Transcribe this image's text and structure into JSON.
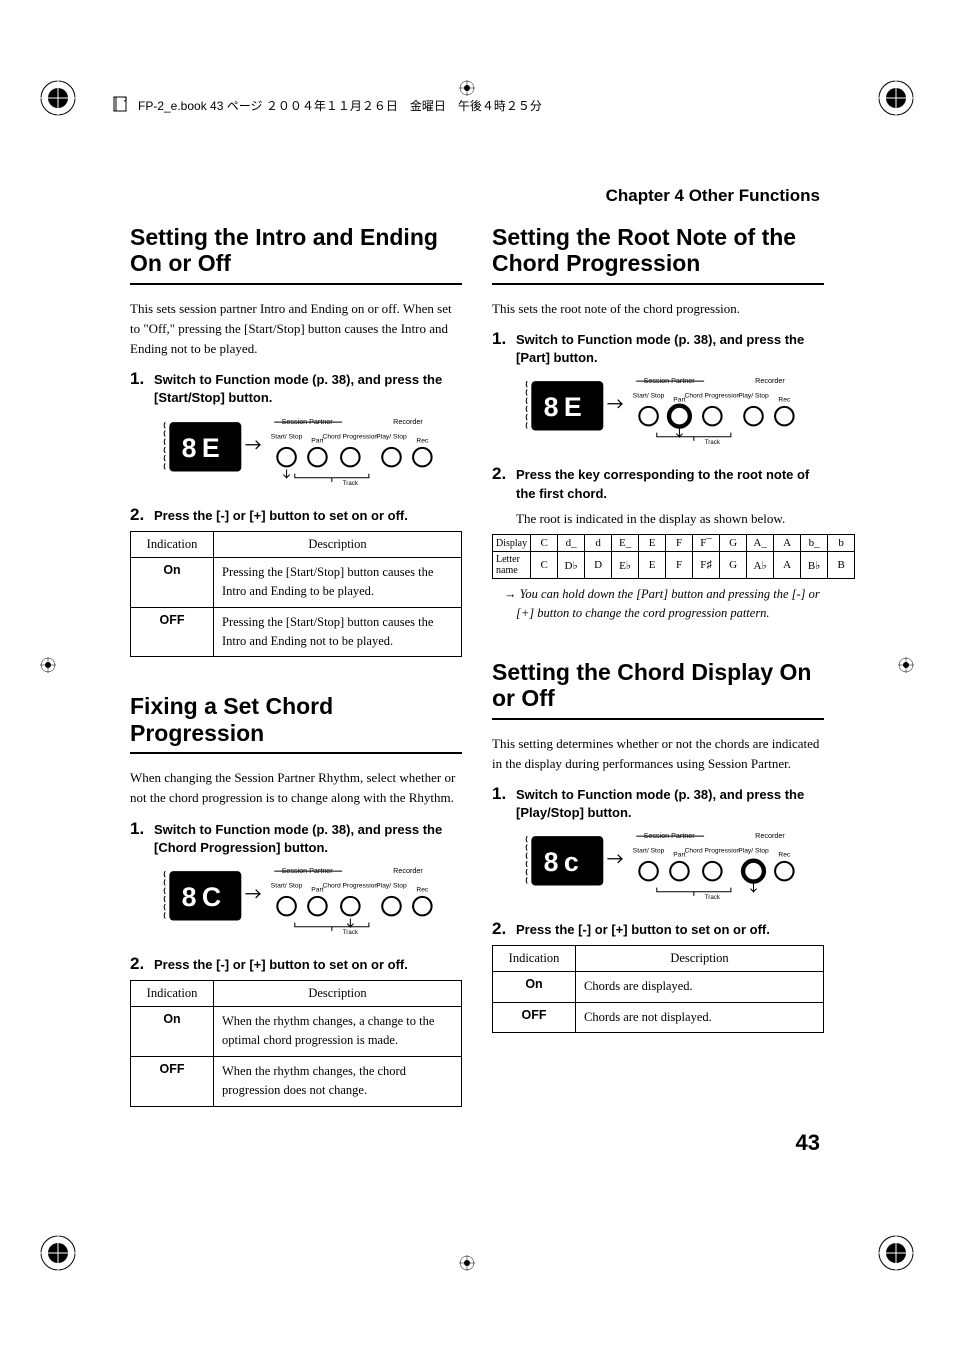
{
  "bookHeader": "FP-2_e.book 43 ページ ２００４年１１月２６日　金曜日　午後４時２５分",
  "chapterTitle": "Chapter 4 Other Functions",
  "pageNumber": "43",
  "left": {
    "sec1": {
      "title": "Setting the Intro and Ending On or Off",
      "intro": "This sets session partner Intro and Ending on or off. When set to \"Off,\" pressing the [Start/Stop] button causes the Intro and Ending not to be played.",
      "step1": "Switch to Function mode (p. 38), and press the [Start/Stop] button.",
      "step2": "Press the [-] or [+] button to set on or off.",
      "tableHead": {
        "c1": "Indication",
        "c2": "Description"
      },
      "rows": [
        {
          "ind": "On",
          "desc": "Pressing the [Start/Stop] button causes the Intro and Ending to be played."
        },
        {
          "ind": "OFF",
          "desc": "Pressing the [Start/Stop] button causes the Intro and Ending not to be played."
        }
      ]
    },
    "sec2": {
      "title": "Fixing a Set Chord Progression",
      "intro": "When changing the Session Partner Rhythm, select whether or not the chord progression is to change along with the Rhythm.",
      "step1": "Switch to Function mode (p. 38), and press the [Chord Progression] button.",
      "step2": "Press the [-] or [+] button to set on or off.",
      "tableHead": {
        "c1": "Indication",
        "c2": "Description"
      },
      "rows": [
        {
          "ind": "On",
          "desc": "When the rhythm changes, a change to the optimal chord progression is made."
        },
        {
          "ind": "OFF",
          "desc": "When the rhythm changes, the chord progression does not change."
        }
      ]
    }
  },
  "right": {
    "sec1": {
      "title": "Setting the Root Note of the Chord Progression",
      "intro": "This sets the root note of the chord progression.",
      "step1": "Switch to Function mode (p. 38), and press the [Part] button.",
      "step2": "Press the key corresponding to the root note of the first chord.",
      "sub": "The root is indicated in the display as shown below.",
      "rootTable": {
        "r1label": "Display",
        "r1": [
          "C",
          "d_",
          "d",
          "E_",
          "E",
          "F",
          "F¯",
          "G",
          "A_",
          "A",
          "b_",
          "b"
        ],
        "r2label": "Letter name",
        "r2": [
          "C",
          "D♭",
          "D",
          "E♭",
          "E",
          "F",
          "F♯",
          "G",
          "A♭",
          "A",
          "B♭",
          "B"
        ]
      },
      "note": "→ You can hold down the [Part] button and pressing the [-] or [+] button to change the cord progression pattern."
    },
    "sec2": {
      "title": "Setting the Chord Display On or Off",
      "intro": "This setting determines whether or not the chords are indicated in the display during performances using Session Partner.",
      "step1": "Switch to Function mode (p. 38), and press the [Play/Stop] button.",
      "step2": "Press the [-] or [+] button to set on or off.",
      "tableHead": {
        "c1": "Indication",
        "c2": "Description"
      },
      "rows": [
        {
          "ind": "On",
          "desc": "Chords are displayed."
        },
        {
          "ind": "OFF",
          "desc": "Chords are not displayed."
        }
      ]
    }
  },
  "panelLabels": {
    "sessionPartner": "Session Partner",
    "recorder": "Recorder",
    "startStop": "Start/\nStop",
    "part": "Part",
    "chordProg": "Chord\nProgression",
    "playStop": "Play/\nStop",
    "rec": "Rec",
    "track": "Track"
  },
  "displays": {
    "d1": "8E",
    "d2": "8C",
    "d3": "8E",
    "d4": "8c"
  }
}
